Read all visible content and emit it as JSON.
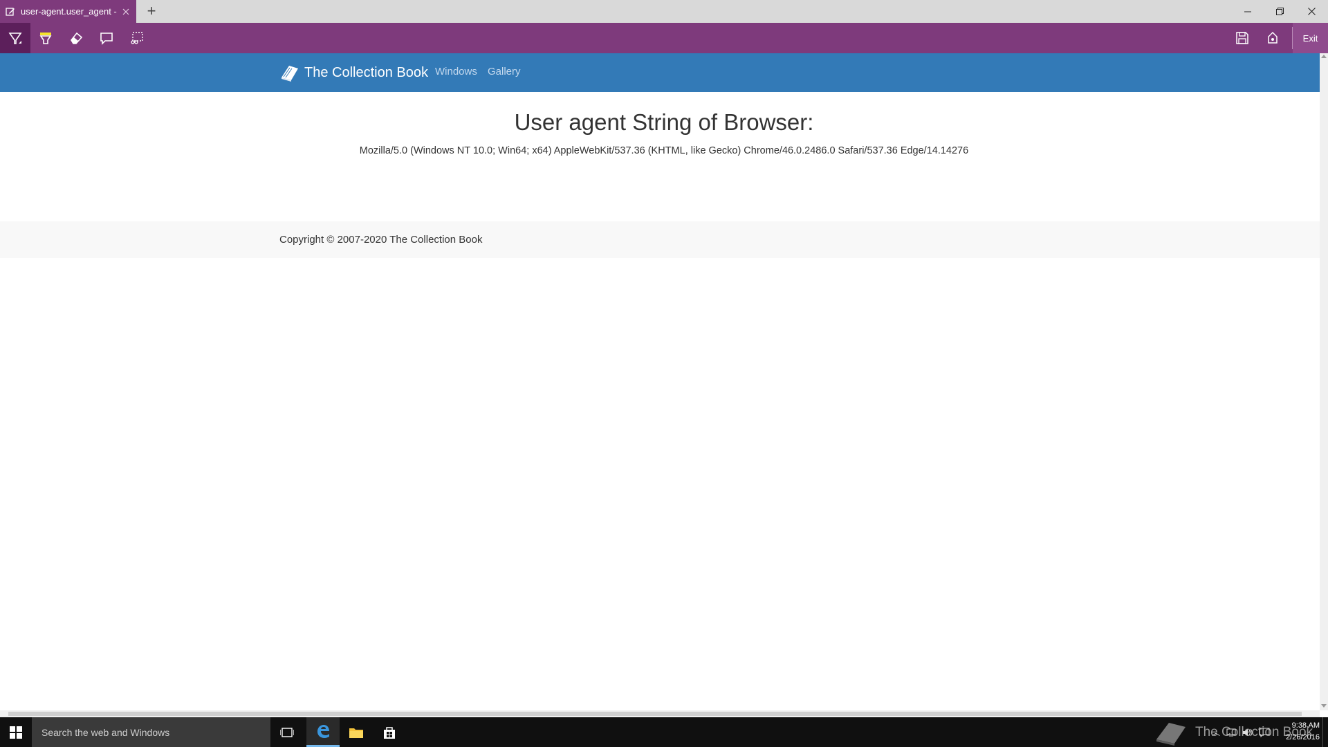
{
  "titlebar": {
    "tab_title": "user-agent.user_agent - ",
    "new_tab_label": "+"
  },
  "toolbar": {
    "exit_label": "Exit"
  },
  "site": {
    "brand": "The Collection Book",
    "nav": [
      "Windows",
      "Gallery"
    ]
  },
  "page": {
    "heading": "User agent String of Browser:",
    "user_agent": "Mozilla/5.0 (Windows NT 10.0; Win64; x64) AppleWebKit/537.36 (KHTML, like Gecko) Chrome/46.0.2486.0 Safari/537.36 Edge/14.14276",
    "copyright": "Copyright © 2007-2020 The Collection Book"
  },
  "taskbar": {
    "search_placeholder": "Search the web and Windows",
    "watermark": "The Collection Book",
    "time": "9:38 AM",
    "date": "2/26/2016"
  },
  "colors": {
    "toolbar_purple": "#7e3a7c",
    "navbar_blue": "#337ab7"
  }
}
